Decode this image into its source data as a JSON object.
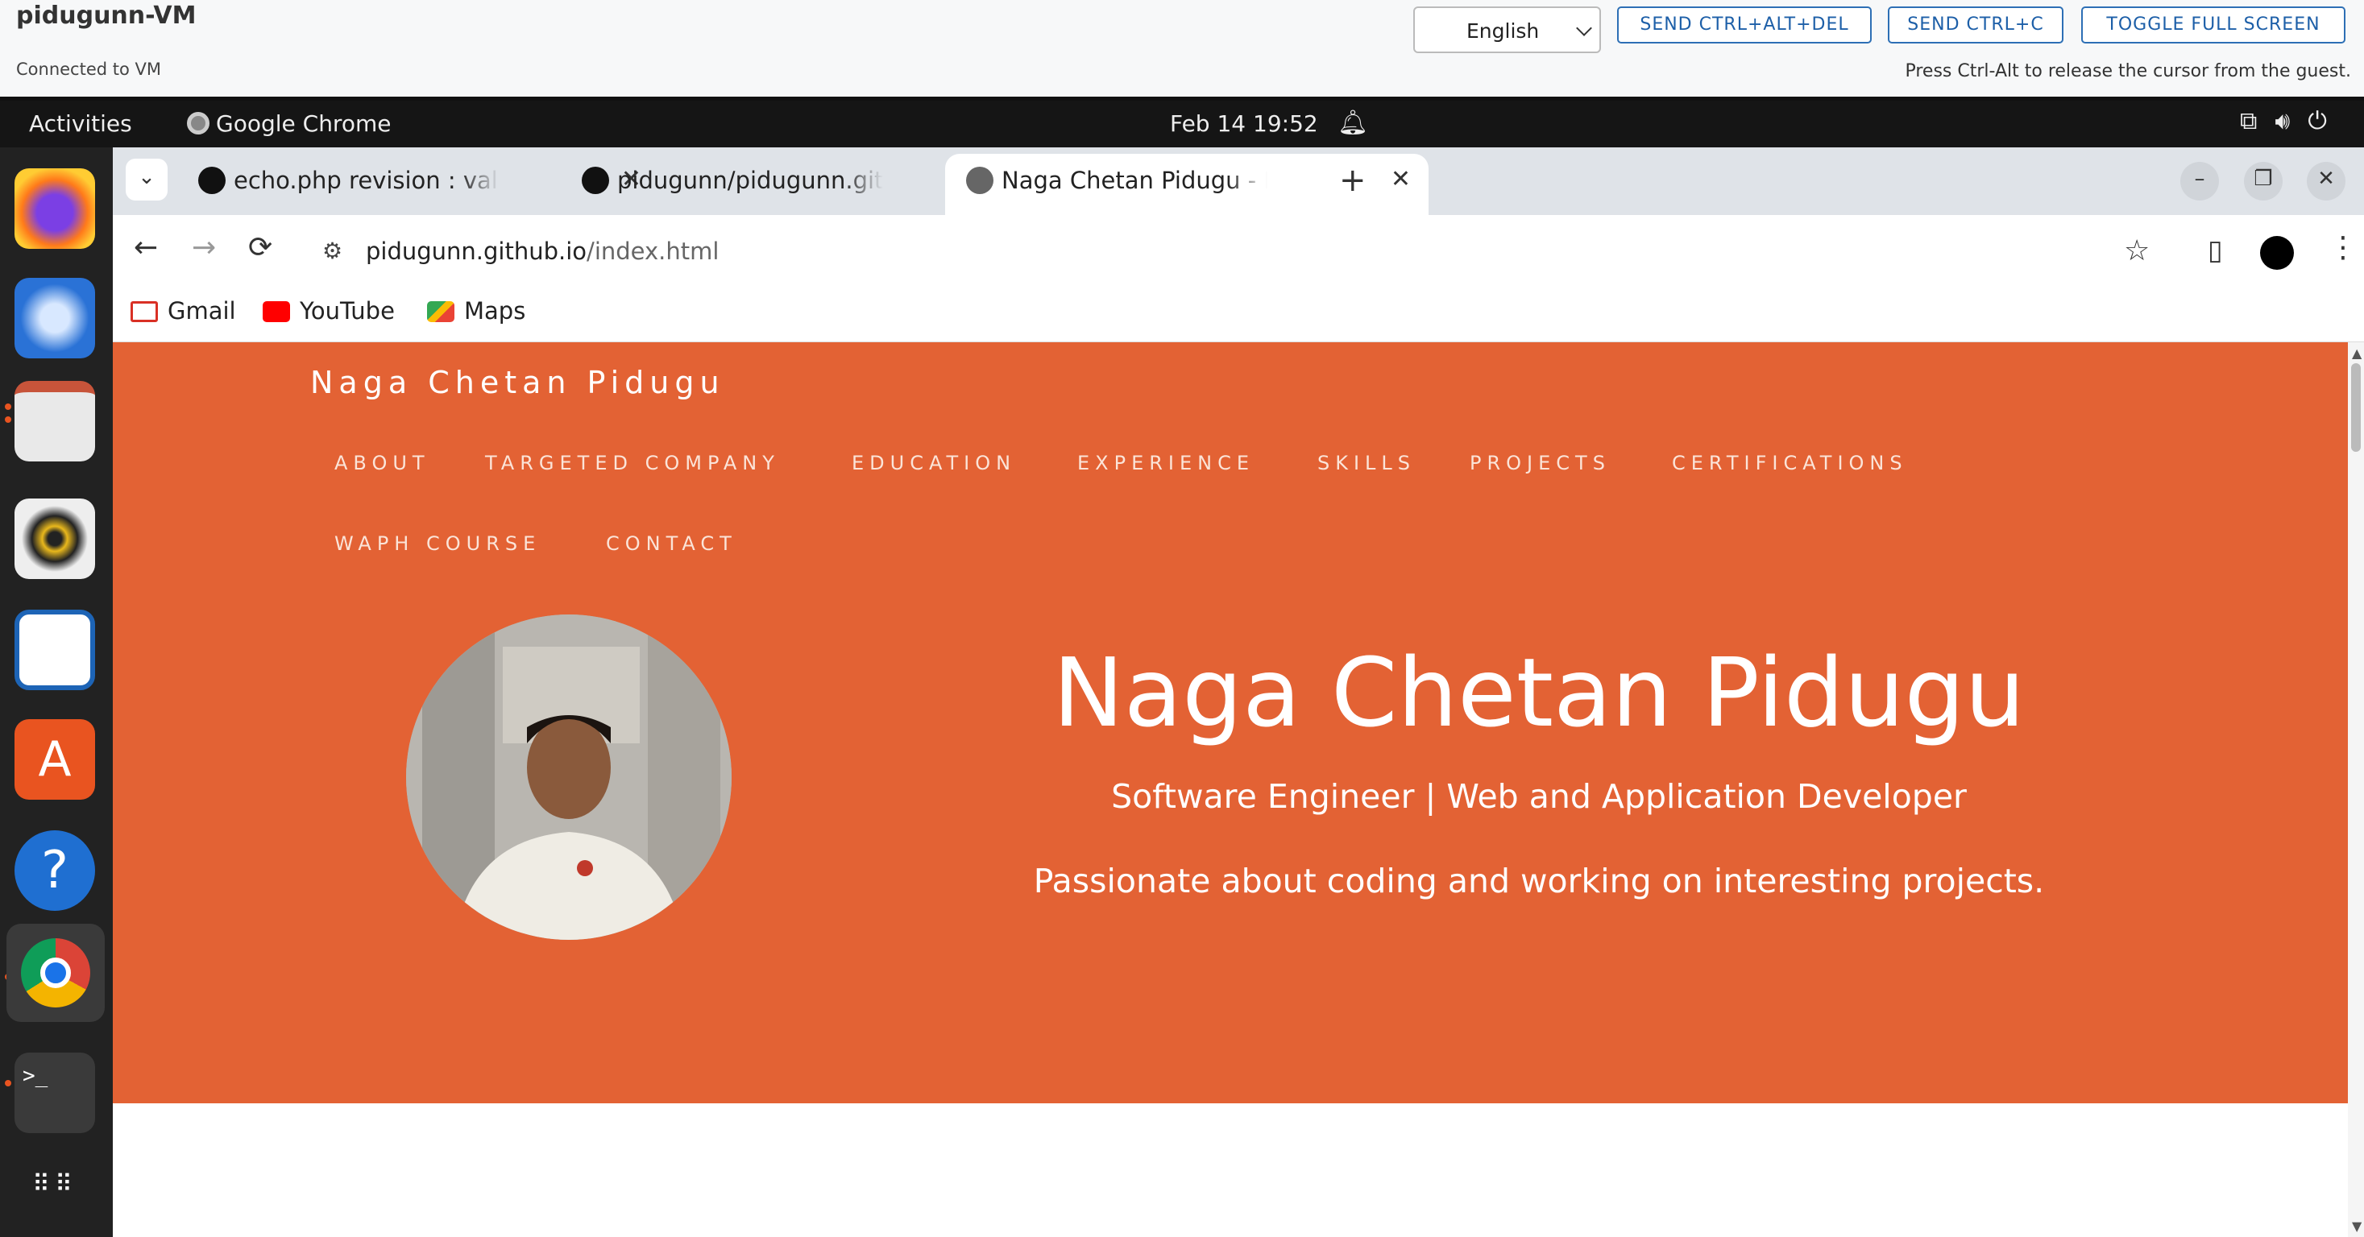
{
  "vm": {
    "title": "pidugunn-VM",
    "status": "Connected to VM",
    "language": "English",
    "buttons": {
      "ctrl_alt_del": "SEND CTRL+ALT+DEL",
      "ctrl_c": "SEND CTRL+C",
      "full_screen": "TOGGLE FULL SCREEN"
    },
    "hint": "Press Ctrl-Alt to release the cursor from the guest."
  },
  "topbar": {
    "activities": "Activities",
    "app": "Google Chrome",
    "clock": "Feb 14  19:52"
  },
  "dock": {
    "items": [
      "firefox-icon",
      "thunderbird-icon",
      "files-icon",
      "rhythmbox-icon",
      "writer-icon",
      "app-center-icon",
      "help-icon",
      "chrome-icon",
      "terminal-icon",
      "app-grid-icon"
    ]
  },
  "browser": {
    "tabs": [
      {
        "title": "echo.php revision : valid",
        "icon": "github-icon"
      },
      {
        "title": "pidugunn/pidugunn.github",
        "icon": "github-icon"
      },
      {
        "title": "Naga Chetan Pidugu - Pr",
        "icon": "globe-icon",
        "active": true
      }
    ],
    "url_host": "pidugunn.github.io",
    "url_path": "/index.html",
    "bookmarks": [
      "Gmail",
      "YouTube",
      "Maps"
    ]
  },
  "site": {
    "brand": "Naga Chetan Pidugu",
    "nav": [
      "ABOUT",
      "TARGETED COMPANY",
      "EDUCATION",
      "EXPERIENCE",
      "SKILLS",
      "PROJECTS",
      "CERTIFICATIONS",
      "WAPH COURSE",
      "CONTACT"
    ],
    "hero_name": "Naga Chetan Pidugu",
    "hero_subtitle": "Software Engineer | Web and Application Developer",
    "hero_tagline": "Passionate about coding and working on interesting projects.",
    "accent": "#e36234"
  }
}
